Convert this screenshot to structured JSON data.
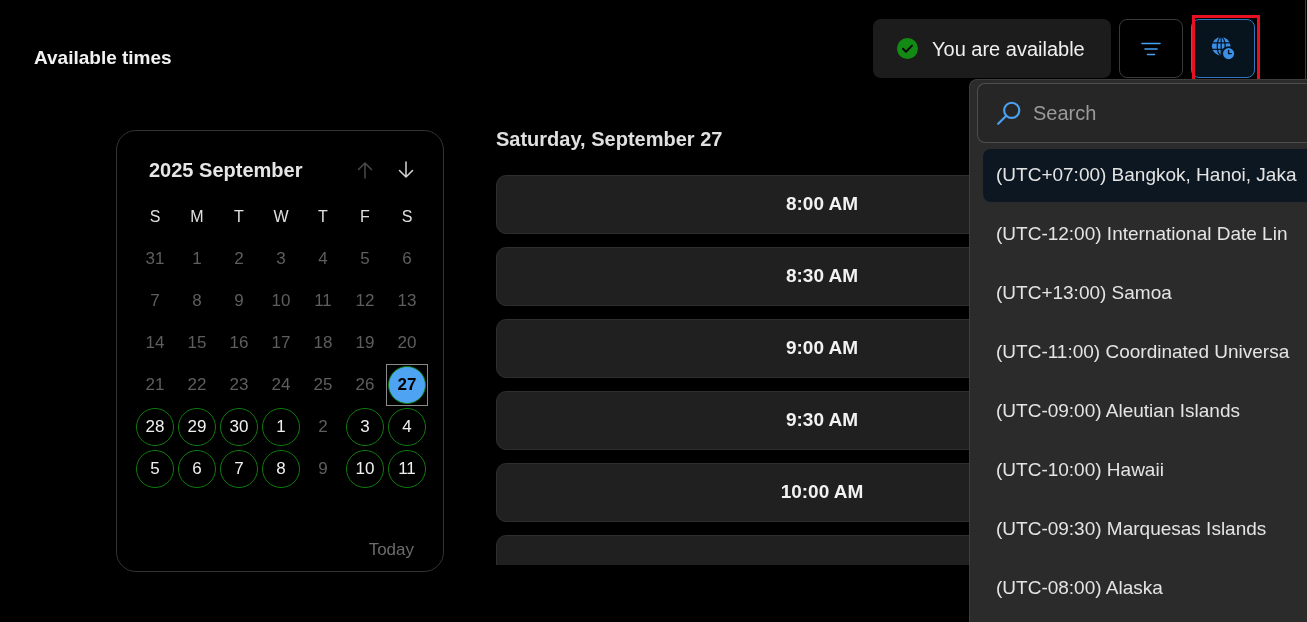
{
  "page": {
    "title": "Available times"
  },
  "status": {
    "label": "You are available",
    "available": true
  },
  "toolbar": [
    {
      "kind": "filter",
      "expanded": false,
      "highlighted": false
    },
    {
      "kind": "timezone",
      "expanded": true,
      "highlighted": true
    }
  ],
  "calendar": {
    "title": "2025 September",
    "nav": [
      {
        "kind": "up",
        "disabled": true
      },
      {
        "kind": "down",
        "disabled": false
      }
    ],
    "weekdays": [
      "S",
      "M",
      "T",
      "W",
      "T",
      "F",
      "S"
    ],
    "weeks": [
      [
        {
          "label": "31",
          "disabled": true,
          "available": false,
          "selected": false
        },
        {
          "label": "1",
          "disabled": true,
          "available": false,
          "selected": false
        },
        {
          "label": "2",
          "disabled": true,
          "available": false,
          "selected": false
        },
        {
          "label": "3",
          "disabled": true,
          "available": false,
          "selected": false
        },
        {
          "label": "4",
          "disabled": true,
          "available": false,
          "selected": false
        },
        {
          "label": "5",
          "disabled": true,
          "available": false,
          "selected": false
        },
        {
          "label": "6",
          "disabled": true,
          "available": false,
          "selected": false
        }
      ],
      [
        {
          "label": "7",
          "disabled": true,
          "available": false,
          "selected": false
        },
        {
          "label": "8",
          "disabled": true,
          "available": false,
          "selected": false
        },
        {
          "label": "9",
          "disabled": true,
          "available": false,
          "selected": false
        },
        {
          "label": "10",
          "disabled": true,
          "available": false,
          "selected": false
        },
        {
          "label": "11",
          "disabled": true,
          "available": false,
          "selected": false
        },
        {
          "label": "12",
          "disabled": true,
          "available": false,
          "selected": false
        },
        {
          "label": "13",
          "disabled": true,
          "available": false,
          "selected": false
        }
      ],
      [
        {
          "label": "14",
          "disabled": true,
          "available": false,
          "selected": false
        },
        {
          "label": "15",
          "disabled": true,
          "available": false,
          "selected": false
        },
        {
          "label": "16",
          "disabled": true,
          "available": false,
          "selected": false
        },
        {
          "label": "17",
          "disabled": true,
          "available": false,
          "selected": false
        },
        {
          "label": "18",
          "disabled": true,
          "available": false,
          "selected": false
        },
        {
          "label": "19",
          "disabled": true,
          "available": false,
          "selected": false
        },
        {
          "label": "20",
          "disabled": true,
          "available": false,
          "selected": false
        }
      ],
      [
        {
          "label": "21",
          "disabled": true,
          "available": false,
          "selected": false
        },
        {
          "label": "22",
          "disabled": true,
          "available": false,
          "selected": false
        },
        {
          "label": "23",
          "disabled": true,
          "available": false,
          "selected": false
        },
        {
          "label": "24",
          "disabled": true,
          "available": false,
          "selected": false
        },
        {
          "label": "25",
          "disabled": true,
          "available": false,
          "selected": false
        },
        {
          "label": "26",
          "disabled": true,
          "available": false,
          "selected": false
        },
        {
          "label": "27",
          "disabled": false,
          "available": true,
          "selected": true
        }
      ],
      [
        {
          "label": "28",
          "disabled": false,
          "available": true,
          "selected": false
        },
        {
          "label": "29",
          "disabled": false,
          "available": true,
          "selected": false
        },
        {
          "label": "30",
          "disabled": false,
          "available": true,
          "selected": false
        },
        {
          "label": "1",
          "disabled": false,
          "available": true,
          "selected": false
        },
        {
          "label": "2",
          "disabled": true,
          "available": false,
          "selected": false
        },
        {
          "label": "3",
          "disabled": false,
          "available": true,
          "selected": false
        },
        {
          "label": "4",
          "disabled": false,
          "available": true,
          "selected": false
        }
      ],
      [
        {
          "label": "5",
          "disabled": false,
          "available": true,
          "selected": false
        },
        {
          "label": "6",
          "disabled": false,
          "available": true,
          "selected": false
        },
        {
          "label": "7",
          "disabled": false,
          "available": true,
          "selected": false
        },
        {
          "label": "8",
          "disabled": false,
          "available": true,
          "selected": false
        },
        {
          "label": "9",
          "disabled": true,
          "available": false,
          "selected": false
        },
        {
          "label": "10",
          "disabled": false,
          "available": true,
          "selected": false
        },
        {
          "label": "11",
          "disabled": false,
          "available": true,
          "selected": false
        }
      ]
    ],
    "footer": "Today"
  },
  "schedule": {
    "heading": "Saturday, September 27",
    "time_slots": [
      {
        "label": "8:00 AM"
      },
      {
        "label": "8:30 AM"
      },
      {
        "label": "9:00 AM"
      },
      {
        "label": "9:30 AM"
      },
      {
        "label": "10:00 AM"
      }
    ]
  },
  "timezone_menu": {
    "search": {
      "placeholder": "Search"
    },
    "items": [
      {
        "label": "(UTC+07:00) Bangkok, Hanoi, Jaka",
        "selected": true
      },
      {
        "label": "(UTC-12:00) International Date Lin",
        "selected": false
      },
      {
        "label": "(UTC+13:00) Samoa",
        "selected": false
      },
      {
        "label": "(UTC-11:00) Coordinated Universa",
        "selected": false
      },
      {
        "label": "(UTC-09:00) Aleutian Islands",
        "selected": false
      },
      {
        "label": "(UTC-10:00) Hawaii",
        "selected": false
      },
      {
        "label": "(UTC-09:30) Marquesas Islands",
        "selected": false
      },
      {
        "label": "(UTC-08:00) Alaska",
        "selected": false
      }
    ]
  }
}
